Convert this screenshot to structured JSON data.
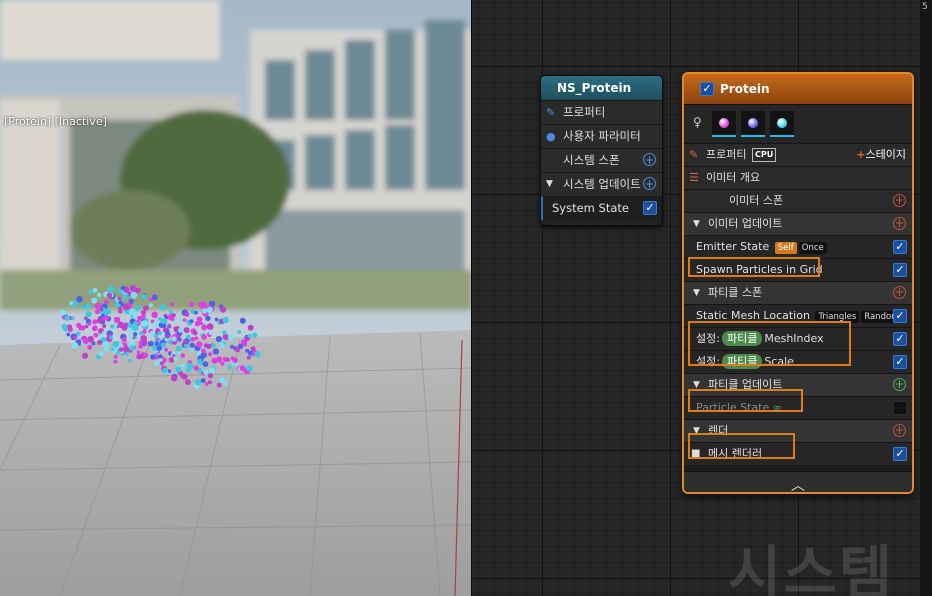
{
  "viewport": {
    "status_label": "[Protein] [Inactive]",
    "particle_colors": [
      "#e040e0",
      "#5060e8",
      "#3ec8e0",
      "#c040c8",
      "#80e0f0"
    ]
  },
  "system_node": {
    "title": "NS_Protein",
    "rows": [
      {
        "label": "프로퍼티",
        "icon": "pencil-icon"
      },
      {
        "label": "사용자 파라미터",
        "icon": "user-icon"
      },
      {
        "label": "시스템 스폰",
        "icon": "plus-icon"
      },
      {
        "label": "시스템 업데이트",
        "icon": "chevron-down-icon"
      },
      {
        "label": "System State",
        "checked": true
      }
    ]
  },
  "emitter_node": {
    "title": "Protein",
    "enabled": true,
    "thumb_colors": [
      "#e040e0",
      "#6060f0",
      "#40d0e8"
    ],
    "properties_label": "프로퍼티",
    "cpu_label": "CPU",
    "stage_label": "스테이지",
    "emitter_summary_label": "이미터 개요",
    "emitter_spawn_label": "이미터 스폰",
    "emitter_update_label": "이미터 업데이트",
    "emitter_state": {
      "label": "Emitter State",
      "tag1": "Self",
      "tag2": "Once"
    },
    "spawn_grid_label": "Spawn Particles in Grid",
    "particle_spawn_label": "파티클 스폰",
    "static_mesh": {
      "label": "Static Mesh Location",
      "tag1": "Triangles",
      "tag2": "Random"
    },
    "set_rows": [
      {
        "prefix": "설정:",
        "pill": "파티클",
        "param": "MeshIndex"
      },
      {
        "prefix": "설정:",
        "pill": "파티클",
        "param": "Scale"
      }
    ],
    "particle_update_label": "파티클 업데이트",
    "particle_state_label": "Particle State",
    "particle_state_icon": "∞",
    "render_label": "렌더",
    "mesh_renderer_label": "메시 렌더러",
    "collapse_icon": "^"
  },
  "watermark": "시스템",
  "right_strip_char": "5"
}
